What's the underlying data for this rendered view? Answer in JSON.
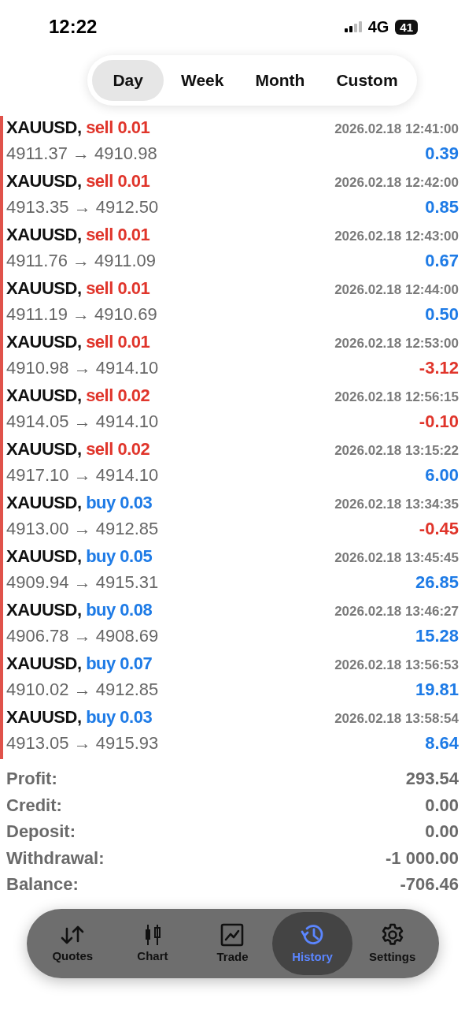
{
  "status_bar": {
    "time": "12:22",
    "network": "4G",
    "battery": "41"
  },
  "period_tabs": [
    {
      "label": "Day",
      "selected": true
    },
    {
      "label": "Week",
      "selected": false
    },
    {
      "label": "Month",
      "selected": false
    },
    {
      "label": "Custom",
      "selected": false
    }
  ],
  "deals": [
    {
      "symbol": "XAUUSD,",
      "side": "sell",
      "volume": "0.01",
      "time": "2026.02.18 12:41:00",
      "prices": "4911.37 → 4910.98",
      "profit": "0.39",
      "kind": "gain"
    },
    {
      "symbol": "XAUUSD,",
      "side": "sell",
      "volume": "0.01",
      "time": "2026.02.18 12:42:00",
      "prices": "4913.35 → 4912.50",
      "profit": "0.85",
      "kind": "gain"
    },
    {
      "symbol": "XAUUSD,",
      "side": "sell",
      "volume": "0.01",
      "time": "2026.02.18 12:43:00",
      "prices": "4911.76 → 4911.09",
      "profit": "0.67",
      "kind": "gain"
    },
    {
      "symbol": "XAUUSD,",
      "side": "sell",
      "volume": "0.01",
      "time": "2026.02.18 12:44:00",
      "prices": "4911.19 → 4910.69",
      "profit": "0.50",
      "kind": "gain"
    },
    {
      "symbol": "XAUUSD,",
      "side": "sell",
      "volume": "0.01",
      "time": "2026.02.18 12:53:00",
      "prices": "4910.98 → 4914.10",
      "profit": "-3.12",
      "kind": "loss"
    },
    {
      "symbol": "XAUUSD,",
      "side": "sell",
      "volume": "0.02",
      "time": "2026.02.18 12:56:15",
      "prices": "4914.05 → 4914.10",
      "profit": "-0.10",
      "kind": "loss"
    },
    {
      "symbol": "XAUUSD,",
      "side": "sell",
      "volume": "0.02",
      "time": "2026.02.18 13:15:22",
      "prices": "4917.10 → 4914.10",
      "profit": "6.00",
      "kind": "gain"
    },
    {
      "symbol": "XAUUSD,",
      "side": "buy",
      "volume": "0.03",
      "time": "2026.02.18 13:34:35",
      "prices": "4913.00 → 4912.85",
      "profit": "-0.45",
      "kind": "loss"
    },
    {
      "symbol": "XAUUSD,",
      "side": "buy",
      "volume": "0.05",
      "time": "2026.02.18 13:45:45",
      "prices": "4909.94 → 4915.31",
      "profit": "26.85",
      "kind": "gain"
    },
    {
      "symbol": "XAUUSD,",
      "side": "buy",
      "volume": "0.08",
      "time": "2026.02.18 13:46:27",
      "prices": "4906.78 → 4908.69",
      "profit": "15.28",
      "kind": "gain"
    },
    {
      "symbol": "XAUUSD,",
      "side": "buy",
      "volume": "0.07",
      "time": "2026.02.18 13:56:53",
      "prices": "4910.02 → 4912.85",
      "profit": "19.81",
      "kind": "gain"
    },
    {
      "symbol": "XAUUSD,",
      "side": "buy",
      "volume": "0.03",
      "time": "2026.02.18 13:58:54",
      "prices": "4913.05 → 4915.93",
      "profit": "8.64",
      "kind": "gain"
    }
  ],
  "summary": [
    {
      "label": "Profit:",
      "value": "293.54"
    },
    {
      "label": "Credit:",
      "value": "0.00"
    },
    {
      "label": "Deposit:",
      "value": "0.00"
    },
    {
      "label": "Withdrawal:",
      "value": "-1 000.00"
    },
    {
      "label": "Balance:",
      "value": "-706.46"
    }
  ],
  "tab_bar": [
    {
      "label": "Quotes",
      "kind": "quotes",
      "selected": false
    },
    {
      "label": "Chart",
      "kind": "chart",
      "selected": false
    },
    {
      "label": "Trade",
      "kind": "trade",
      "selected": false
    },
    {
      "label": "History",
      "kind": "history",
      "selected": true
    },
    {
      "label": "Settings",
      "kind": "settings",
      "selected": false
    }
  ]
}
